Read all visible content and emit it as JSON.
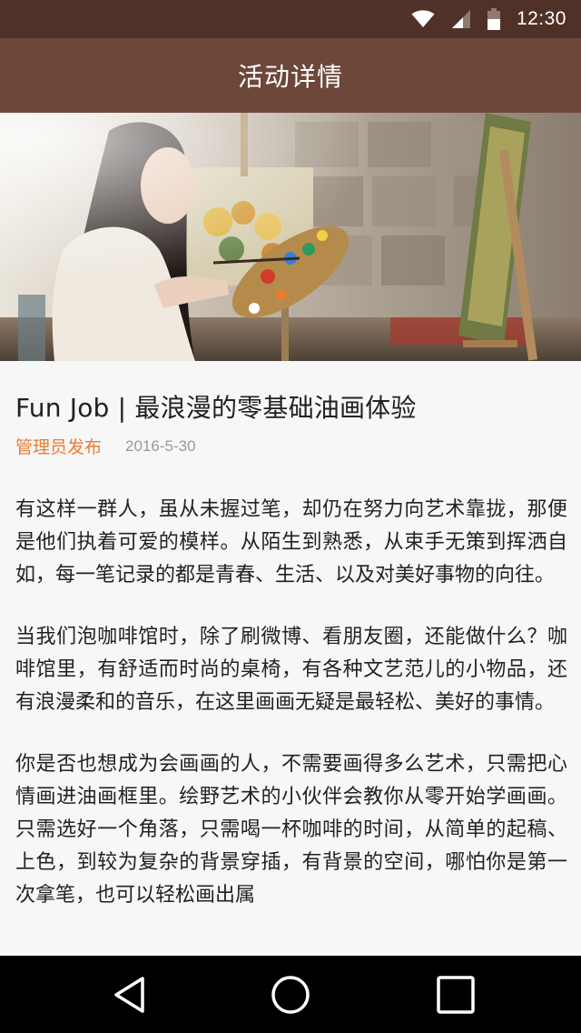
{
  "status_bar": {
    "time": "12:30",
    "icons": [
      "wifi-icon",
      "cell-signal-icon",
      "battery-icon"
    ]
  },
  "app_bar": {
    "title": "活动详情"
  },
  "hero": {
    "icon": "painting-photo"
  },
  "article": {
    "title": "Fun Job | 最浪漫的零基础油画体验",
    "publisher": "管理员发布",
    "date": "2016-5-30",
    "paragraphs": [
      "有这样一群人，虽从未握过笔，却仍在努力向艺术靠拢，那便是他们执着可爱的模样。从陌生到熟悉，从束手无策到挥洒自如，每一笔记录的都是青春、生活、以及对美好事物的向往。",
      "当我们泡咖啡馆时，除了刷微博、看朋友圈，还能做什么？咖啡馆里，有舒适而时尚的桌椅，有各种文艺范儿的小物品，还有浪漫柔和的音乐，在这里画画无疑是最轻松、美好的事情。",
      "你是否也想成为会画画的人，不需要画得多么艺术，只需把心情画进油画框里。绘野艺术的小伙伴会教你从零开始学画画。只需选好一个角落，只需喝一杯咖啡的时间，从简单的起稿、上色，到较为复杂的背景穿插，有背景的空间，哪怕你是第一次拿笔，也可以轻松画出属"
    ]
  },
  "colors": {
    "status_bar": "#4f3128",
    "app_bar": "#6e473b",
    "publisher": "#ee7b2f",
    "date": "#9a9a9a",
    "nav_bar": "#000000"
  },
  "nav_bar": {
    "buttons": [
      "back-icon",
      "home-icon",
      "recents-icon"
    ]
  }
}
